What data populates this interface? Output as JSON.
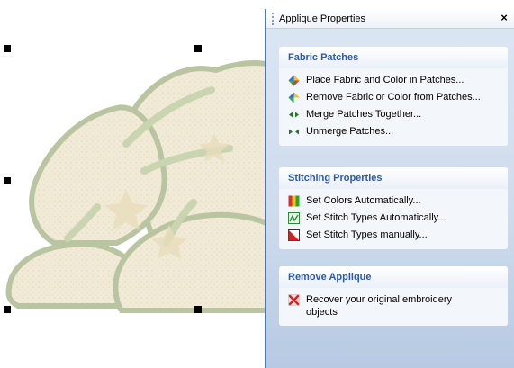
{
  "panel": {
    "title": "Applique Properties",
    "close_glyph": "×"
  },
  "groups": [
    {
      "heading": "Fabric Patches",
      "items": [
        {
          "label": "Place Fabric and Color in Patches...",
          "icon": "color-patch-icon"
        },
        {
          "label": "Remove Fabric or Color from Patches...",
          "icon": "color-patch-remove-icon"
        },
        {
          "label": "Merge Patches Together...",
          "icon": "merge-arrows-icon"
        },
        {
          "label": "Unmerge Patches...",
          "icon": "unmerge-arrows-icon"
        }
      ]
    },
    {
      "heading": "Stitching Properties",
      "items": [
        {
          "label": "Set Colors Automatically...",
          "icon": "color-bars-icon"
        },
        {
          "label": "Set Stitch Types Automatically...",
          "icon": "stitch-auto-icon"
        },
        {
          "label": "Set Stitch Types manually...",
          "icon": "stitch-manual-icon"
        }
      ]
    },
    {
      "heading": "Remove Applique",
      "items": [
        {
          "label": "Recover your original embroidery objects",
          "icon": "red-x-icon"
        }
      ]
    }
  ],
  "colors": {
    "panel_border": "#4f76ad",
    "heading_text": "#2b5aa6",
    "fabric": "#f0e8d4",
    "stitch_edge": "#c9d4b0",
    "red_x": "#d42020"
  }
}
